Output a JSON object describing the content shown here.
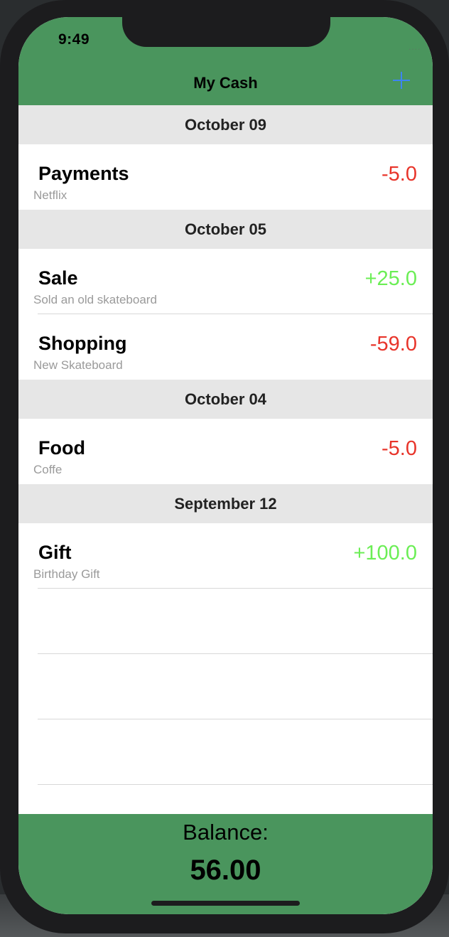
{
  "status_bar": {
    "time": "9:49",
    "cellular": "...."
  },
  "nav": {
    "title": "My Cash",
    "add_icon": "plus-icon"
  },
  "sections": [
    {
      "date": "October 09",
      "items": [
        {
          "category": "Payments",
          "description": "Netflix",
          "amount": "-5.0",
          "type": "expense"
        }
      ]
    },
    {
      "date": "October 05",
      "items": [
        {
          "category": "Sale",
          "description": "Sold an old skateboard",
          "amount": "+25.0",
          "type": "income"
        },
        {
          "category": "Shopping",
          "description": "New Skateboard",
          "amount": "-59.0",
          "type": "expense"
        }
      ]
    },
    {
      "date": "October 04",
      "items": [
        {
          "category": "Food",
          "description": "Coffe",
          "amount": "-5.0",
          "type": "expense"
        }
      ]
    },
    {
      "date": "September 12",
      "items": [
        {
          "category": "Gift",
          "description": "Birthday Gift",
          "amount": "+100.0",
          "type": "income"
        }
      ]
    }
  ],
  "footer": {
    "balance_label": "Balance:",
    "balance_value": "56.00"
  },
  "colors": {
    "header_green": "#4a955d",
    "expense_red": "#e8342a",
    "income_green": "#6bee55",
    "add_blue": "#3d84f2",
    "section_gray": "#e6e6e6"
  }
}
